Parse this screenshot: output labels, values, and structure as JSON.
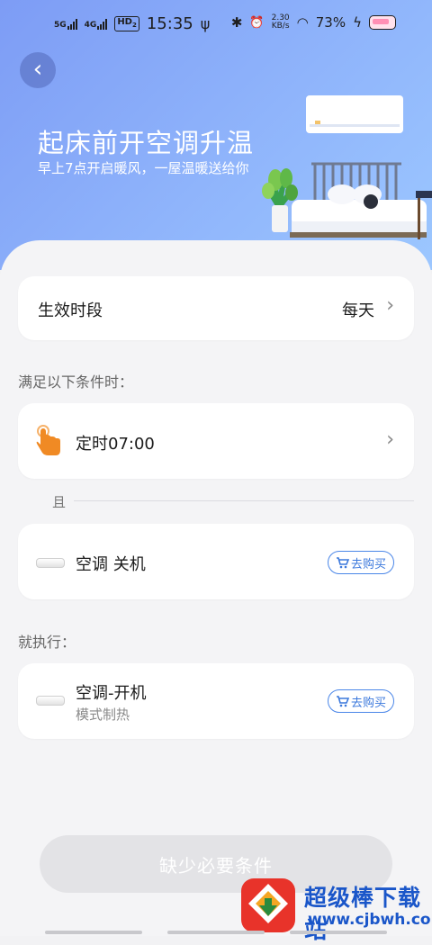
{
  "status_bar": {
    "sim1": "5G",
    "sim2": "4G",
    "hd": "HD",
    "hd_sub": "2",
    "time": "15:35",
    "usb": "ψ",
    "bluetooth": "✱",
    "alarm": "⏰",
    "speed_value": "2.30",
    "speed_unit": "KB/s",
    "wifi": "◠",
    "battery_percent": "73%",
    "charging": "ϟ"
  },
  "header": {
    "back_glyph": "‹",
    "title": "起床前开空调升温",
    "subtitle": "早上7点开启暖风，一屋温暖送给你"
  },
  "effective_period": {
    "label": "生效时段",
    "value": "每天",
    "chevron": "›"
  },
  "conditions": {
    "section_label": "满足以下条件时：",
    "timer": {
      "label": "定时07:00",
      "icon": "hand-tap-icon",
      "chevron": "›"
    },
    "and_label": "且",
    "ac_state": {
      "label": "空调 关机",
      "icon": "air-conditioner-icon",
      "buy_label": "去购买"
    }
  },
  "actions": {
    "section_label": "就执行：",
    "ac_on": {
      "label": "空调-开机",
      "sublabel": "模式制热",
      "icon": "air-conditioner-icon",
      "buy_label": "去购买"
    }
  },
  "bottom_button": {
    "label": "缺少必要条件"
  },
  "watermark": {
    "line1": "超级棒下载站",
    "line2": "www.cjbwh.com"
  },
  "colors": {
    "hero_start": "#7d9cf5",
    "hero_end": "#9cc7ff",
    "accent": "#3b78dc",
    "hand_icon": "#f08a24"
  }
}
